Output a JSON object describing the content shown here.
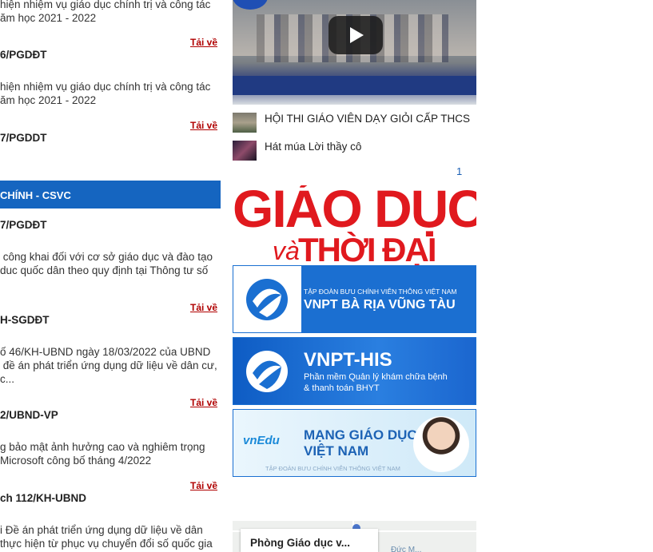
{
  "documents": [
    {
      "desc": "hiện nhiệm vụ giáo dục chính trị và công tác\năm học 2021 - 2022",
      "download": "Tải về"
    },
    {
      "code": "6/PGDĐT",
      "desc": "hiện nhiệm vụ giáo dục chính trị và công tác\năm học 2021 - 2022",
      "download": "Tải về"
    },
    {
      "code": "7/PGDDT"
    }
  ],
  "section_title": "CHÍNH - CSVC",
  "section_docs": [
    {
      "code": "7/PGDĐT",
      "desc": " công khai đối với cơ sở giáo dục và đào tạo\nduc quốc dân theo quy định tại Thông tư số",
      "download": "Tải về"
    },
    {
      "code": "H-SGDĐT",
      "desc": "ố 46/KH-UBND ngày 18/03/2022 của UBND\n đề án phát triển ứng dụng dữ liệu về dân cư,\nc...",
      "download": "Tải về"
    },
    {
      "code": "2/UBND-VP",
      "desc": "g bảo mật ảnh hưởng cao và nghiêm trọng\nMicrosoft công bố tháng 4/2022",
      "download": "Tải về"
    },
    {
      "code": "ch 112/KH-UBND",
      "desc": "i Đề án phát triển ứng dụng dữ liệu về dân\nthực hiện từ phục vụ chuyển đổi số quốc gia"
    }
  ],
  "videos": [
    {
      "title": "HỘI THI GIÁO VIÊN DẠY GIỎI CẤP THCS"
    },
    {
      "title": "Hát múa Lời thầy cô"
    }
  ],
  "video_page": "1",
  "banners": {
    "gddt_line1": "GIÁO DỤC",
    "gddt_va": "và",
    "gddt_line2": "THỜI ĐẠI",
    "vnpt_brvt_small": "TẬP ĐOÀN BƯU CHÍNH VIỄN THÔNG VIỆT NAM",
    "vnpt_brvt_big": "VNPT BÀ RỊA VŨNG TÀU",
    "vnpt_his_big": "VNPT-HIS",
    "vnpt_his_sub1": "Phần mềm Quản lý khám chữa bệnh",
    "vnpt_his_sub2": "& thanh toán BHYT",
    "vnedu_logo": "vnEdu",
    "vnedu_line1": "MẠNG GIÁO DỤC",
    "vnedu_line2": "VIỆT NAM",
    "vnedu_footer": "TẬP ĐOÀN BƯU CHÍNH VIỄN THÔNG VIỆT NAM"
  },
  "map": {
    "place_name": "Phòng Giáo dục v...",
    "street_label": "Đức M..."
  },
  "colors": {
    "section_bar": "#1565c0",
    "download_link": "#b00000",
    "gddt_red": "#e0191e",
    "vnpt_blue": "#1a6fd1"
  }
}
